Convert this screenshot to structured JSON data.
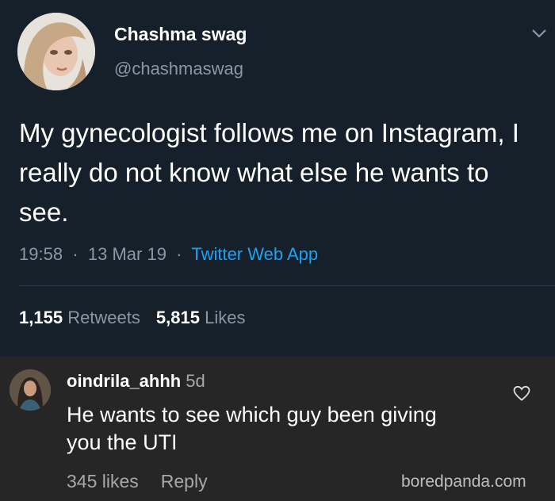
{
  "tweet": {
    "display_name": "Chashma swag",
    "handle": "@chashmaswag",
    "text": "My gynecologist follows me on Instagram, I really do not know what else he wants to see.",
    "time": "19:58",
    "date": "13 Mar 19",
    "source": "Twitter Web App",
    "retweets_count": "1,155",
    "retweets_label": "Retweets",
    "likes_count": "5,815",
    "likes_label": "Likes"
  },
  "comment": {
    "username": "oindrila_ahhh",
    "age": "5d",
    "text": "He wants to see which guy been giving you the UTI",
    "likes": "345 likes",
    "reply_label": "Reply"
  },
  "watermark": "boredpanda.com",
  "icons": {
    "tweet_menu": "chevron-down-icon",
    "comment_like": "heart-icon"
  },
  "colors": {
    "tweet_bg": "#15202b",
    "comment_bg": "#262626",
    "link_blue": "#1da1f2",
    "muted": "#8899a6"
  }
}
